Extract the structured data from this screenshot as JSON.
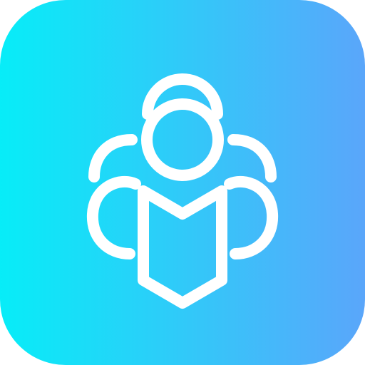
{
  "app_icon": {
    "symbol": "reading-person-icon",
    "colors": {
      "gradient_start": "#07EDF8",
      "gradient_end": "#5AA6FA",
      "glyph": "#FFFFFF",
      "page_background": "#FFFFFF"
    }
  }
}
